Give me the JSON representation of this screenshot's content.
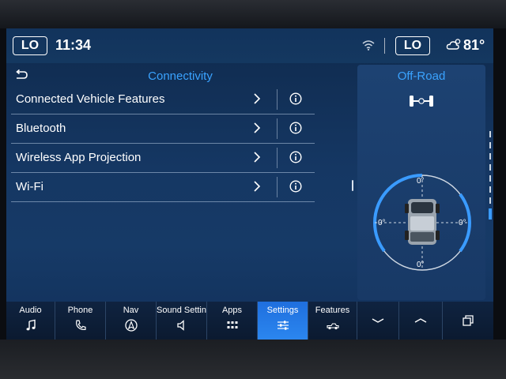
{
  "status_bar": {
    "left_temp": "LO",
    "time": "11:34",
    "right_temp": "LO",
    "outside_temp": "81°",
    "icons": [
      "wifi-icon",
      "weather-icon"
    ]
  },
  "connectivity": {
    "title": "Connectivity",
    "items": [
      {
        "label": "Connected Vehicle Features"
      },
      {
        "label": "Bluetooth"
      },
      {
        "label": "Wireless App Projection"
      },
      {
        "label": "Wi-Fi"
      }
    ]
  },
  "offroad": {
    "title": "Off-Road",
    "pitch_front": "0°",
    "pitch_rear": "0°",
    "roll_left": "0°",
    "roll_right": "0°"
  },
  "nav": {
    "tabs": [
      {
        "label": "Audio",
        "icon": "music-note-icon"
      },
      {
        "label": "Phone",
        "icon": "phone-icon"
      },
      {
        "label": "Nav",
        "icon": "navigation-arrow-icon"
      },
      {
        "label": "Sound Settin",
        "icon": "speaker-icon"
      },
      {
        "label": "Apps",
        "icon": "apps-grid-icon"
      },
      {
        "label": "Settings",
        "icon": "sliders-icon"
      },
      {
        "label": "Features",
        "icon": "truck-icon"
      }
    ],
    "active_tab": "Settings"
  },
  "colors": {
    "accent": "#3aa3ff",
    "active_tab": "#2b86ef",
    "background": "#153763"
  }
}
